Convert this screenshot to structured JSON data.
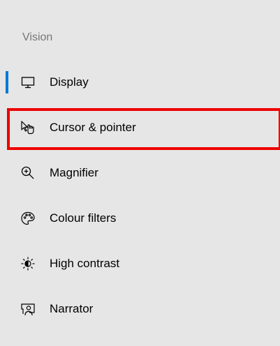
{
  "sidebar": {
    "heading": "Vision",
    "items": [
      {
        "label": "Display",
        "icon": "monitor-icon",
        "selected": true
      },
      {
        "label": "Cursor & pointer",
        "icon": "pointer-hand-icon",
        "selected": false,
        "highlighted": true
      },
      {
        "label": "Magnifier",
        "icon": "magnifier-icon",
        "selected": false
      },
      {
        "label": "Colour filters",
        "icon": "palette-icon",
        "selected": false
      },
      {
        "label": "High contrast",
        "icon": "brightness-icon",
        "selected": false
      },
      {
        "label": "Narrator",
        "icon": "narrator-icon",
        "selected": false
      }
    ]
  },
  "colors": {
    "background": "#e6e6e6",
    "accent": "#0078d7",
    "highlight": "#ee0000",
    "heading": "#767676"
  }
}
